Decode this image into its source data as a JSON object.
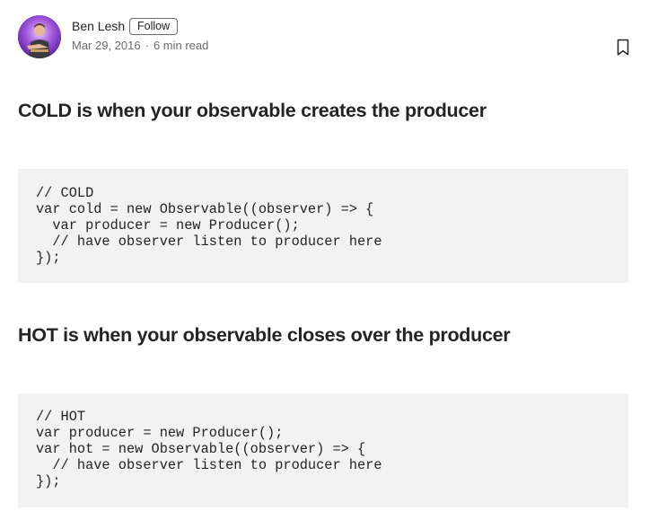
{
  "author": {
    "name": "Ben Lesh",
    "follow_label": "Follow",
    "date": "Mar 29, 2016",
    "separator": "·",
    "read_time": "6 min read"
  },
  "icons": {
    "bookmark": "bookmark-icon",
    "avatar": "avatar"
  },
  "sections": [
    {
      "heading": "COLD is when your observable creates the producer",
      "code": [
        "// COLD",
        "var cold = new Observable((observer) => {",
        "  var producer = new Producer();",
        "  // have observer listen to producer here",
        "});"
      ]
    },
    {
      "heading": "HOT is when your observable closes over the producer",
      "code": [
        "// HOT",
        "var producer = new Producer();",
        "var hot = new Observable((observer) => {",
        "  // have observer listen to producer here",
        "});"
      ]
    }
  ],
  "colors": {
    "text": "#242424",
    "muted": "#6b6b6b",
    "code_bg": "#f2f2f2"
  }
}
